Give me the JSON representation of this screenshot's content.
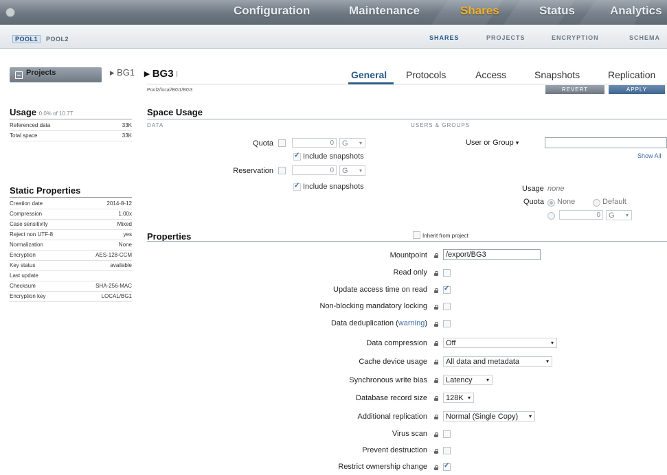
{
  "topnav": {
    "tabs": [
      "Configuration",
      "Maintenance",
      "Shares",
      "Status",
      "Analytics"
    ],
    "active": "Shares",
    "active_color": "#f3b22a"
  },
  "subnav": {
    "pools": [
      "POOL1",
      "POOL2"
    ],
    "sections": [
      "SHARES",
      "PROJECTS",
      "ENCRYPTION",
      "SCHEMA"
    ]
  },
  "header": {
    "projects_label": "Projects",
    "breadcrumb_parent": "BG1",
    "breadcrumb_current": "BG3",
    "tabs": [
      "General",
      "Protocols",
      "Access",
      "Snapshots",
      "Replication"
    ],
    "path": "Pool2/local/BG1/BG3",
    "revert_label": "REVERT",
    "apply_label": "APPLY"
  },
  "sidebar": {
    "usage_title": "Usage",
    "usage_sub": "0.0% of 10.7T",
    "usage_rows": [
      {
        "k": "Referenced data",
        "v": "33K"
      },
      {
        "k": "Total space",
        "v": "33K"
      }
    ],
    "static_title": "Static Properties",
    "static_rows": [
      {
        "k": "Creation date",
        "v": "2014-8-12"
      },
      {
        "k": "Compression",
        "v": "1.00x"
      },
      {
        "k": "Case sensitivity",
        "v": "Mixed"
      },
      {
        "k": "Reject non UTF-8",
        "v": "yes"
      },
      {
        "k": "Normalization",
        "v": "None"
      },
      {
        "k": "Encryption",
        "v": "AES-128-CCM"
      },
      {
        "k": "Key status",
        "v": "available"
      },
      {
        "k": "Last update",
        "v": ""
      },
      {
        "k": "Checksum",
        "v": "SHA-256-MAC"
      },
      {
        "k": "Encryption key",
        "v": "LOCAL/BG1"
      }
    ]
  },
  "space_usage": {
    "title": "Space Usage",
    "data_header": "DATA",
    "users_header": "USERS & GROUPS",
    "quota_label": "Quota",
    "quota_value": "0",
    "quota_unit": "G",
    "include_snapshots": "Include snapshots",
    "reservation_label": "Reservation",
    "reservation_value": "0",
    "reservation_unit": "G",
    "user_or_group": "User or Group",
    "show_all": "Show All",
    "usage_label": "Usage",
    "usage_value": "none",
    "ug_quota_label": "Quota",
    "none_label": "None",
    "default_label": "Default",
    "ug_quota_value": "0",
    "ug_quota_unit": "G"
  },
  "properties": {
    "title": "Properties",
    "inherit_label": "Inherit from project",
    "mountpoint_label": "Mountpoint",
    "mountpoint_value": "/export/BG3",
    "read_only_label": "Read only",
    "update_access_label": "Update access time on read",
    "nonblocking_label": "Non-blocking mandatory locking",
    "dedup_label": "Data deduplication (",
    "dedup_link": "warning",
    "dedup_close": ")",
    "compression_label": "Data compression",
    "compression_value": "Off",
    "cache_label": "Cache device usage",
    "cache_value": "All data and metadata",
    "sync_label": "Synchronous write bias",
    "sync_value": "Latency",
    "recsize_label": "Database record size",
    "recsize_value": "128K",
    "replication_label": "Additional replication",
    "replication_value": "Normal (Single Copy)",
    "virus_label": "Virus scan",
    "prevent_label": "Prevent destruction",
    "restrict_label": "Restrict ownership change"
  },
  "icons": [
    "logo-icon",
    "lock-icon",
    "chevron-down-icon",
    "minus-box-icon",
    "text-cursor-icon"
  ]
}
